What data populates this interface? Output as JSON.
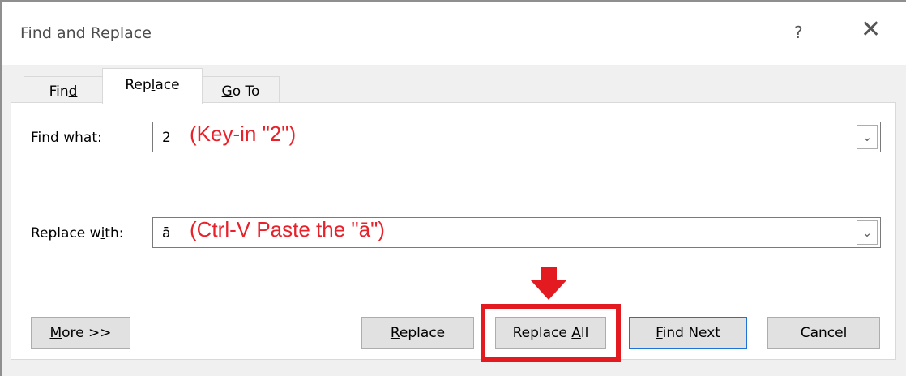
{
  "dialog": {
    "title": "Find and Replace",
    "help_label": "?",
    "close_label": "✕"
  },
  "tabs": [
    {
      "pre": "Fin",
      "key": "d",
      "post": "",
      "active": false
    },
    {
      "pre": "Rep",
      "key": "l",
      "post": "ace",
      "active": true
    },
    {
      "pre": "",
      "key": "G",
      "post": "o To",
      "active": false
    }
  ],
  "find": {
    "label_pre": "Fi",
    "label_key": "n",
    "label_post": "d what:",
    "value": "2",
    "annotation": "(Key-in \"2\")"
  },
  "replace": {
    "label_pre": "Replace w",
    "label_key": "i",
    "label_post": "th:",
    "value": "ā",
    "annotation": "(Ctrl-V Paste the \"ā\")"
  },
  "dropdown_icon": "chevron-down",
  "buttons": {
    "more": {
      "pre": "",
      "key": "M",
      "post": "ore >>"
    },
    "replace": {
      "pre": "",
      "key": "R",
      "post": "eplace"
    },
    "replace_all": {
      "pre": "Replace ",
      "key": "A",
      "post": "ll"
    },
    "find_next": {
      "pre": "",
      "key": "F",
      "post": "ind Next"
    },
    "cancel": {
      "label": "Cancel"
    }
  },
  "colors": {
    "annotation": "#e8212a",
    "highlight_box": "#e31a1f",
    "default_button_border": "#1e74d6"
  }
}
